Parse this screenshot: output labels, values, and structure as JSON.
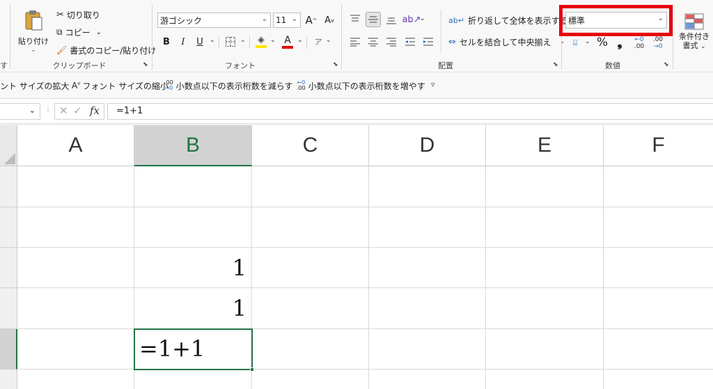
{
  "ribbon": {
    "clipboard": {
      "partial_left": "す",
      "paste": "貼り付け",
      "cut": "切り取り",
      "copy": "コピー",
      "format_painter": "書式のコピー/貼り付け",
      "group_label": "クリップボード"
    },
    "font": {
      "font_name": "游ゴシック",
      "font_size": "11",
      "grow": "A",
      "shrink": "A",
      "bold": "B",
      "italic": "I",
      "underline": "U",
      "font_color_glyph": "A",
      "phonetic_glyph": "ア",
      "group_label": "フォント"
    },
    "alignment": {
      "wrap_text": "折り返して全体を表示する",
      "merge_center": "セルを結合して中央揃え",
      "group_label": "配置"
    },
    "number": {
      "format_value": "標準",
      "percent": "%",
      "comma": "❟",
      "inc_decimal_a": "←0",
      "inc_decimal_b": ".00",
      "dec_decimal_a": ".00",
      "dec_decimal_b": "→0",
      "group_label": "数値"
    },
    "styles": {
      "conditional_line1": "条件付き",
      "conditional_line2": "書式"
    }
  },
  "qat": {
    "font_grow": "ント サイズの拡大",
    "font_shrink": "フォント サイズの縮小",
    "dec_decimal": "小数点以下の表示桁数を減らす",
    "inc_decimal": "小数点以下の表示桁数を増やす"
  },
  "formula_bar": {
    "fx": "fx",
    "formula": "=1+1"
  },
  "sheet": {
    "columns": [
      "A",
      "B",
      "C",
      "D",
      "E",
      "F"
    ],
    "cells": {
      "B3": "1",
      "B4": "1",
      "B5": "=1+1"
    }
  },
  "colors": {
    "accent_green": "#217346",
    "highlight_red": "#e8000e",
    "font_color_red": "#e00000",
    "fill_yellow": "#ffe600"
  }
}
